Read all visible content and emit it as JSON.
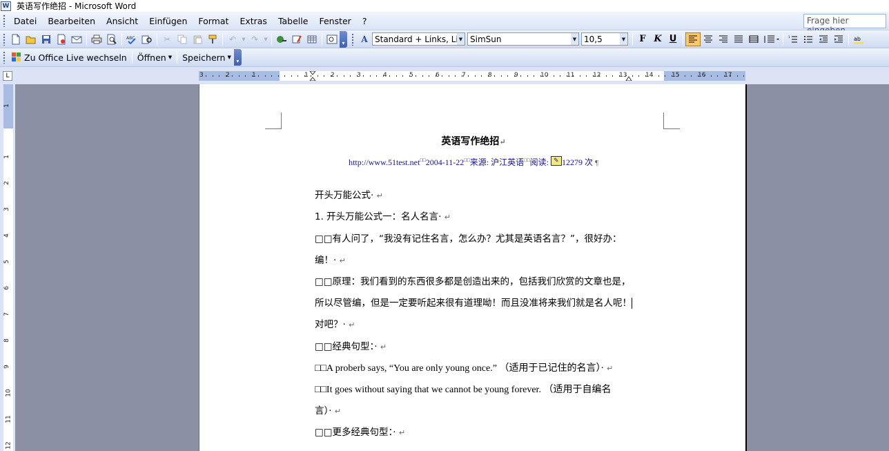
{
  "window": {
    "title": "英语写作绝招 - Microsoft Word",
    "app_icon_glyph": "W"
  },
  "menubar": {
    "items": [
      "Datei",
      "Bearbeiten",
      "Ansicht",
      "Einfügen",
      "Format",
      "Extras",
      "Tabelle",
      "Fenster",
      "?"
    ],
    "help_placeholder": "Frage hier eingeben"
  },
  "formatting": {
    "style": "Standard + Links, Links",
    "font": "SimSun",
    "size": "10,5",
    "bold": "F",
    "italic": "K",
    "underline": "U"
  },
  "toolbar2": {
    "office_live": "Zu Office Live wechseln",
    "open": "Öffnen",
    "save": "Speichern"
  },
  "ruler": {
    "h_numbers": [
      "3",
      "2",
      "1",
      "1",
      "2",
      "3",
      "4",
      "5",
      "6",
      "7",
      "8",
      "9",
      "10",
      "11",
      "12",
      "13",
      "14",
      "15",
      "16",
      "17"
    ],
    "v_numbers": [
      "1",
      "1",
      "2",
      "3",
      "4",
      "5",
      "6",
      "7",
      "8",
      "9",
      "10",
      "11",
      "12"
    ]
  },
  "document": {
    "title": "英语写作绝招",
    "source": {
      "url": "http://www.51test.net",
      "date": "2004-11-22",
      "source_label": "来源:",
      "source_name": "沪江英语",
      "reads_label": "阅读:",
      "count": "12279",
      "count_suffix": "次"
    },
    "paragraphs": [
      "开头万能公式",
      "1. 开头万能公式一：名人名言",
      "□□有人问了，“我没有记住名言，怎么办？尤其是英语名言？”，很好办：",
      "编！",
      "□□原理：我们看到的东西很多都是创造出来的，包括我们欣赏的文章也是，",
      "所以尽管编，但是一定要听起来很有道理呦！而且没准将来我们就是名人呢！",
      "对吧？",
      "□□经典句型：",
      "□□A proberb says, “You are only young once.” （适用于已记住的名言）",
      "□□It goes without saying that we cannot be young forever. （适用于自编名",
      "言）",
      "□□更多经典句型："
    ]
  }
}
